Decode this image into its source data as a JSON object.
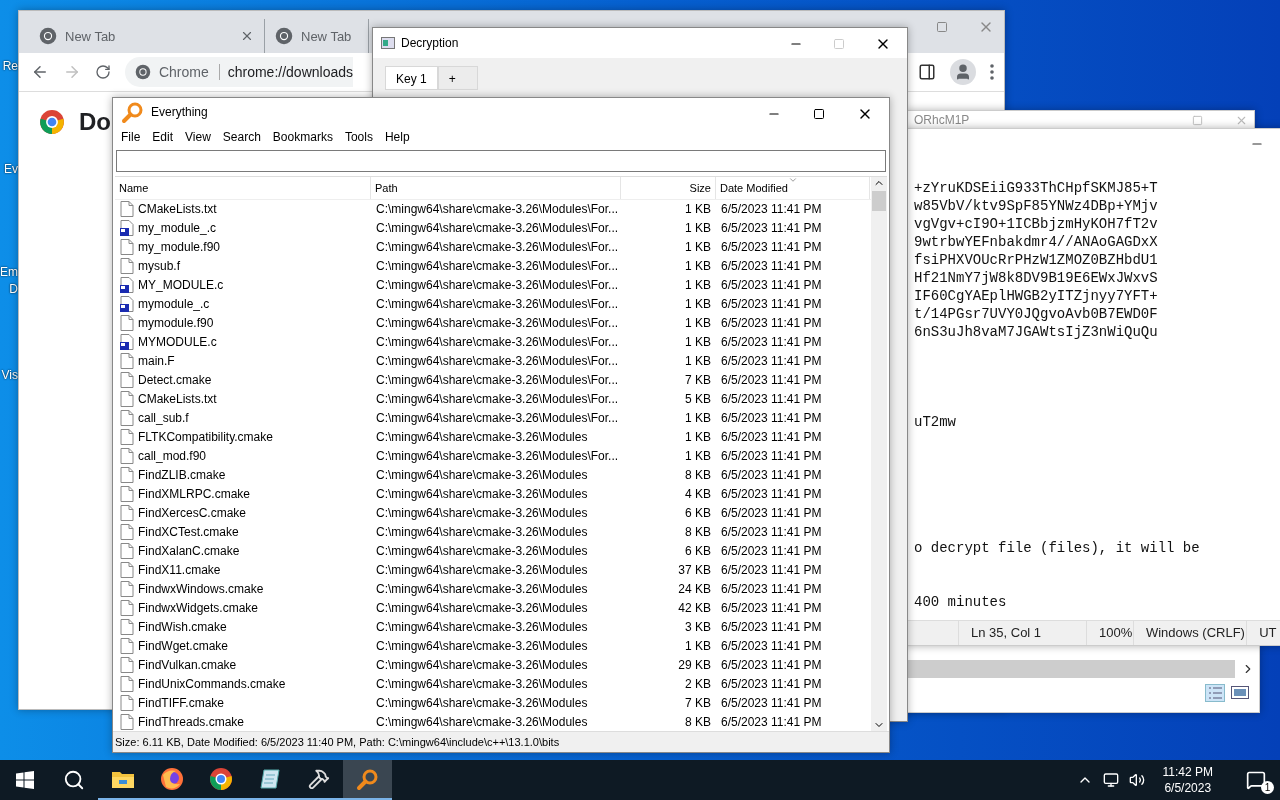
{
  "desktop": {
    "icons": [
      {
        "label": "Re"
      },
      {
        "label": "Ev"
      },
      {
        "label": "Em D"
      },
      {
        "label": "Vis"
      }
    ]
  },
  "chrome": {
    "tabs": [
      {
        "title": "New Tab",
        "closable": true
      },
      {
        "title": "New Tab",
        "closable": false
      }
    ],
    "address": {
      "site": "Chrome",
      "url": "chrome://downloads"
    },
    "page_heading": "Do"
  },
  "background_window": {
    "title": "ORhcM1P"
  },
  "notepad": {
    "blocks": [
      [
        "+zYruKDSEiiG933ThCHpfSKMJ85+T",
        "w85VbV/ktv9SpF85YNWz4DBp+YMjv",
        "vgVgv+cI9O+1ICBbjzmHyKOH7fT2v",
        "9wtrbwYEFnbakdmr4//ANAoGAGDxX",
        "fsiPHXVOUcRrPHzW1ZMOZ0BZHbdU1",
        "Hf21NmY7jW8k8DV9B19E6EWxJWxvS",
        "IF60CgYAEplHWGB2yITZjnyy7YFT+",
        "t/14PGsr7UVY0JQgvoAvb0B7EWD0F",
        "6nS3uJh8vaM7JGAWtsIjZ3nWiQuQu"
      ],
      [
        "uT2mw"
      ],
      [
        "o decrypt file (files), it will be"
      ],
      [
        "400 minutes"
      ]
    ],
    "status": [
      "Ln 35, Col 1",
      "100%",
      "Windows (CRLF)",
      "UT"
    ]
  },
  "decryption": {
    "title": "Decryption",
    "tabs": [
      {
        "label": "Key 1",
        "selected": true
      },
      {
        "label": "+",
        "selected": false
      }
    ]
  },
  "everything": {
    "title": "Everything",
    "menu": [
      "File",
      "Edit",
      "View",
      "Search",
      "Bookmarks",
      "Tools",
      "Help"
    ],
    "columns": [
      {
        "label": "Name",
        "sorted": false
      },
      {
        "label": "Path",
        "sorted": false
      },
      {
        "label": "Size",
        "sorted": false
      },
      {
        "label": "Date Modified",
        "sorted": true
      }
    ],
    "rows": [
      {
        "kind": "text",
        "name": "CMakeLists.txt",
        "path": "C:\\mingw64\\share\\cmake-3.26\\Modules\\For...",
        "size": "1 KB",
        "date": "6/5/2023 11:41 PM"
      },
      {
        "kind": "source",
        "name": "my_module_.c",
        "path": "C:\\mingw64\\share\\cmake-3.26\\Modules\\For...",
        "size": "1 KB",
        "date": "6/5/2023 11:41 PM"
      },
      {
        "kind": "text",
        "name": "my_module.f90",
        "path": "C:\\mingw64\\share\\cmake-3.26\\Modules\\For...",
        "size": "1 KB",
        "date": "6/5/2023 11:41 PM"
      },
      {
        "kind": "text",
        "name": "mysub.f",
        "path": "C:\\mingw64\\share\\cmake-3.26\\Modules\\For...",
        "size": "1 KB",
        "date": "6/5/2023 11:41 PM"
      },
      {
        "kind": "source",
        "name": "MY_MODULE.c",
        "path": "C:\\mingw64\\share\\cmake-3.26\\Modules\\For...",
        "size": "1 KB",
        "date": "6/5/2023 11:41 PM"
      },
      {
        "kind": "source",
        "name": "mymodule_.c",
        "path": "C:\\mingw64\\share\\cmake-3.26\\Modules\\For...",
        "size": "1 KB",
        "date": "6/5/2023 11:41 PM"
      },
      {
        "kind": "text",
        "name": "mymodule.f90",
        "path": "C:\\mingw64\\share\\cmake-3.26\\Modules\\For...",
        "size": "1 KB",
        "date": "6/5/2023 11:41 PM"
      },
      {
        "kind": "source",
        "name": "MYMODULE.c",
        "path": "C:\\mingw64\\share\\cmake-3.26\\Modules\\For...",
        "size": "1 KB",
        "date": "6/5/2023 11:41 PM"
      },
      {
        "kind": "text",
        "name": "main.F",
        "path": "C:\\mingw64\\share\\cmake-3.26\\Modules\\For...",
        "size": "1 KB",
        "date": "6/5/2023 11:41 PM"
      },
      {
        "kind": "text",
        "name": "Detect.cmake",
        "path": "C:\\mingw64\\share\\cmake-3.26\\Modules\\For...",
        "size": "7 KB",
        "date": "6/5/2023 11:41 PM"
      },
      {
        "kind": "text",
        "name": "CMakeLists.txt",
        "path": "C:\\mingw64\\share\\cmake-3.26\\Modules\\For...",
        "size": "5 KB",
        "date": "6/5/2023 11:41 PM"
      },
      {
        "kind": "text",
        "name": "call_sub.f",
        "path": "C:\\mingw64\\share\\cmake-3.26\\Modules\\For...",
        "size": "1 KB",
        "date": "6/5/2023 11:41 PM"
      },
      {
        "kind": "text",
        "name": "FLTKCompatibility.cmake",
        "path": "C:\\mingw64\\share\\cmake-3.26\\Modules",
        "size": "1 KB",
        "date": "6/5/2023 11:41 PM"
      },
      {
        "kind": "text",
        "name": "call_mod.f90",
        "path": "C:\\mingw64\\share\\cmake-3.26\\Modules\\For...",
        "size": "1 KB",
        "date": "6/5/2023 11:41 PM"
      },
      {
        "kind": "text",
        "name": "FindZLIB.cmake",
        "path": "C:\\mingw64\\share\\cmake-3.26\\Modules",
        "size": "8 KB",
        "date": "6/5/2023 11:41 PM"
      },
      {
        "kind": "text",
        "name": "FindXMLRPC.cmake",
        "path": "C:\\mingw64\\share\\cmake-3.26\\Modules",
        "size": "4 KB",
        "date": "6/5/2023 11:41 PM"
      },
      {
        "kind": "text",
        "name": "FindXercesC.cmake",
        "path": "C:\\mingw64\\share\\cmake-3.26\\Modules",
        "size": "6 KB",
        "date": "6/5/2023 11:41 PM"
      },
      {
        "kind": "text",
        "name": "FindXCTest.cmake",
        "path": "C:\\mingw64\\share\\cmake-3.26\\Modules",
        "size": "8 KB",
        "date": "6/5/2023 11:41 PM"
      },
      {
        "kind": "text",
        "name": "FindXalanC.cmake",
        "path": "C:\\mingw64\\share\\cmake-3.26\\Modules",
        "size": "6 KB",
        "date": "6/5/2023 11:41 PM"
      },
      {
        "kind": "text",
        "name": "FindX11.cmake",
        "path": "C:\\mingw64\\share\\cmake-3.26\\Modules",
        "size": "37 KB",
        "date": "6/5/2023 11:41 PM"
      },
      {
        "kind": "text",
        "name": "FindwxWindows.cmake",
        "path": "C:\\mingw64\\share\\cmake-3.26\\Modules",
        "size": "24 KB",
        "date": "6/5/2023 11:41 PM"
      },
      {
        "kind": "text",
        "name": "FindwxWidgets.cmake",
        "path": "C:\\mingw64\\share\\cmake-3.26\\Modules",
        "size": "42 KB",
        "date": "6/5/2023 11:41 PM"
      },
      {
        "kind": "text",
        "name": "FindWish.cmake",
        "path": "C:\\mingw64\\share\\cmake-3.26\\Modules",
        "size": "3 KB",
        "date": "6/5/2023 11:41 PM"
      },
      {
        "kind": "text",
        "name": "FindWget.cmake",
        "path": "C:\\mingw64\\share\\cmake-3.26\\Modules",
        "size": "1 KB",
        "date": "6/5/2023 11:41 PM"
      },
      {
        "kind": "text",
        "name": "FindVulkan.cmake",
        "path": "C:\\mingw64\\share\\cmake-3.26\\Modules",
        "size": "29 KB",
        "date": "6/5/2023 11:41 PM"
      },
      {
        "kind": "text",
        "name": "FindUnixCommands.cmake",
        "path": "C:\\mingw64\\share\\cmake-3.26\\Modules",
        "size": "2 KB",
        "date": "6/5/2023 11:41 PM"
      },
      {
        "kind": "text",
        "name": "FindTIFF.cmake",
        "path": "C:\\mingw64\\share\\cmake-3.26\\Modules",
        "size": "7 KB",
        "date": "6/5/2023 11:41 PM"
      },
      {
        "kind": "text",
        "name": "FindThreads.cmake",
        "path": "C:\\mingw64\\share\\cmake-3.26\\Modules",
        "size": "8 KB",
        "date": "6/5/2023 11:41 PM"
      }
    ],
    "status": "Size: 6.11 KB, Date Modified: 6/5/2023 11:40 PM, Path: C:\\mingw64\\include\\c++\\13.1.0\\bits"
  },
  "taskbar": {
    "apps": [
      {
        "kind": "explorer",
        "active": false
      },
      {
        "kind": "firefox",
        "active": false
      },
      {
        "kind": "chrome",
        "active": false
      },
      {
        "kind": "notepad",
        "active": false
      },
      {
        "kind": "tools",
        "active": false
      },
      {
        "kind": "everything",
        "active": true
      }
    ],
    "time": "11:42 PM",
    "date": "6/5/2023",
    "notifications": "1"
  }
}
